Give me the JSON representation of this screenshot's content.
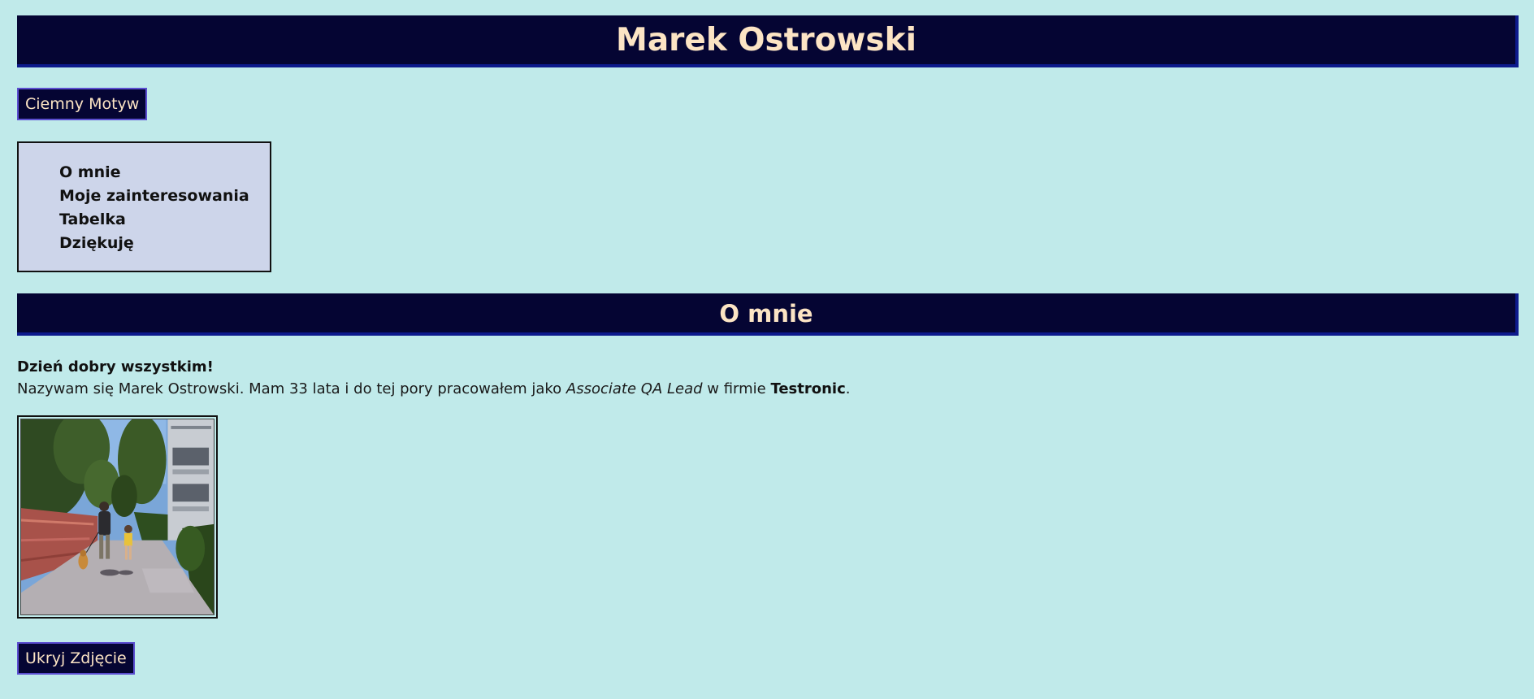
{
  "header": {
    "title": "Marek Ostrowski"
  },
  "buttons": {
    "theme_label": "Ciemny Motyw",
    "hide_photo_label": "Ukryj Zdjęcie"
  },
  "nav": {
    "items": [
      {
        "label": "O mnie"
      },
      {
        "label": "Moje zainteresowania"
      },
      {
        "label": "Tabelka"
      },
      {
        "label": "Dziękuję"
      }
    ]
  },
  "section": {
    "title": "O mnie",
    "greeting": "Dzień dobry wszystkim!",
    "bio_part1": "Nazywam się Marek Ostrowski. Mam 33 lata i do tej pory pracowałem jako ",
    "bio_role": "Associate QA Lead",
    "bio_part2": " w firmie ",
    "bio_company": "Testronic",
    "bio_end": "."
  },
  "colors": {
    "background": "#c0eaea",
    "header_bg": "#050533",
    "header_text": "#fce4c4",
    "header_border": "#0d1a8c",
    "nav_bg": "#cdd5ea",
    "button_border": "#5b4ed0"
  },
  "photo": {
    "icon": "photo-walk-with-dog"
  }
}
